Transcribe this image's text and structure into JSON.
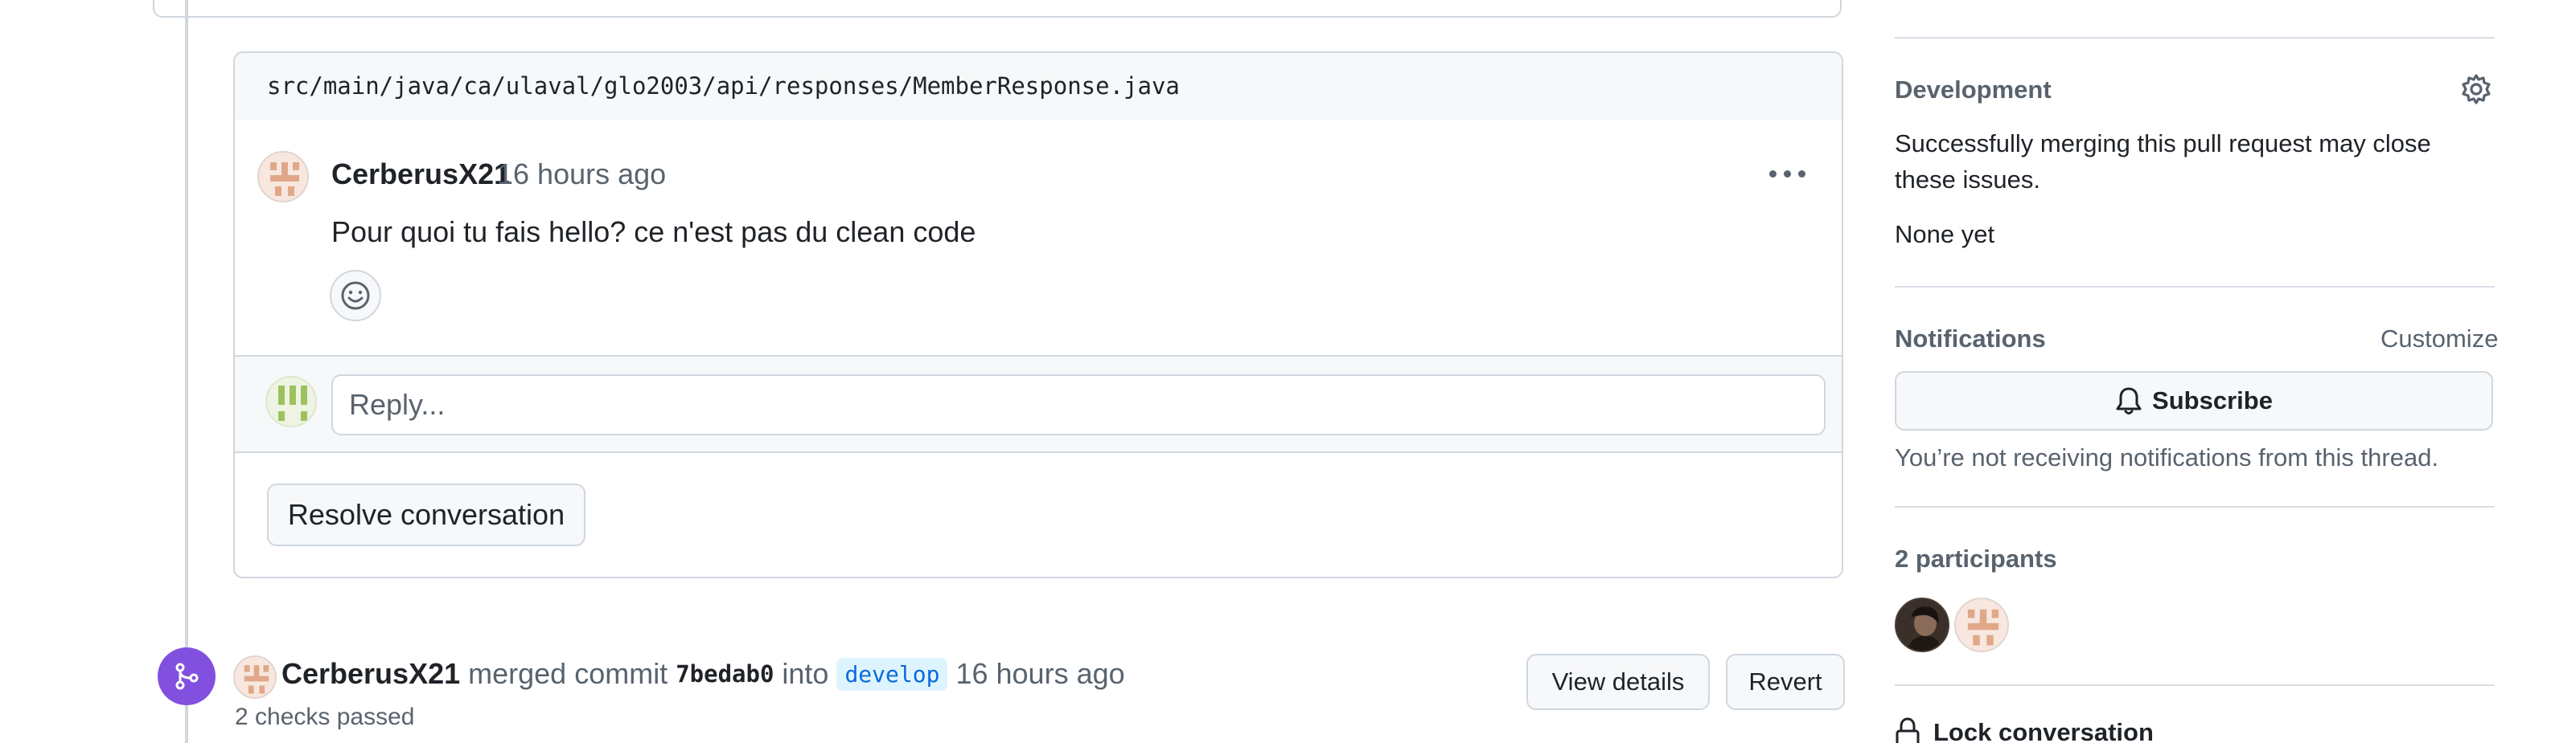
{
  "thread": {
    "file_path": "src/main/java/ca/ulaval/glo2003/api/responses/MemberResponse.java",
    "comment": {
      "author": "CerberusX21",
      "time": "16 hours ago",
      "body": "Pour quoi tu fais hello? ce n'est pas du clean code",
      "more_icon": "kebab-horizontal-icon",
      "reaction_icon": "smiley-icon"
    },
    "reply_placeholder": "Reply...",
    "resolve_label": "Resolve conversation"
  },
  "merge_event": {
    "icon": "git-merge-icon",
    "author": "CerberusX21",
    "action": "merged commit",
    "sha": "7bedab0",
    "into": "into",
    "branch": "develop",
    "time": "16 hours ago",
    "checks": "2 checks passed",
    "view_details_label": "View details",
    "revert_label": "Revert"
  },
  "sidebar": {
    "development": {
      "heading": "Development",
      "description": "Successfully merging this pull request may close these issues.",
      "status": "None yet",
      "settings_icon": "gear-icon"
    },
    "notifications": {
      "heading": "Notifications",
      "customize_label": "Customize",
      "subscribe_label": "Subscribe",
      "subscribe_icon": "bell-icon",
      "status_text": "You’re not receiving notifications from this thread."
    },
    "participants": {
      "heading": "2 participants"
    },
    "lock": {
      "label": "Lock conversation",
      "icon": "lock-icon"
    }
  },
  "colors": {
    "accent_purple": "#8250df",
    "branch_bg": "#ddf4ff",
    "branch_fg": "#0969da",
    "border": "#d0d7de",
    "muted": "#59636e"
  }
}
